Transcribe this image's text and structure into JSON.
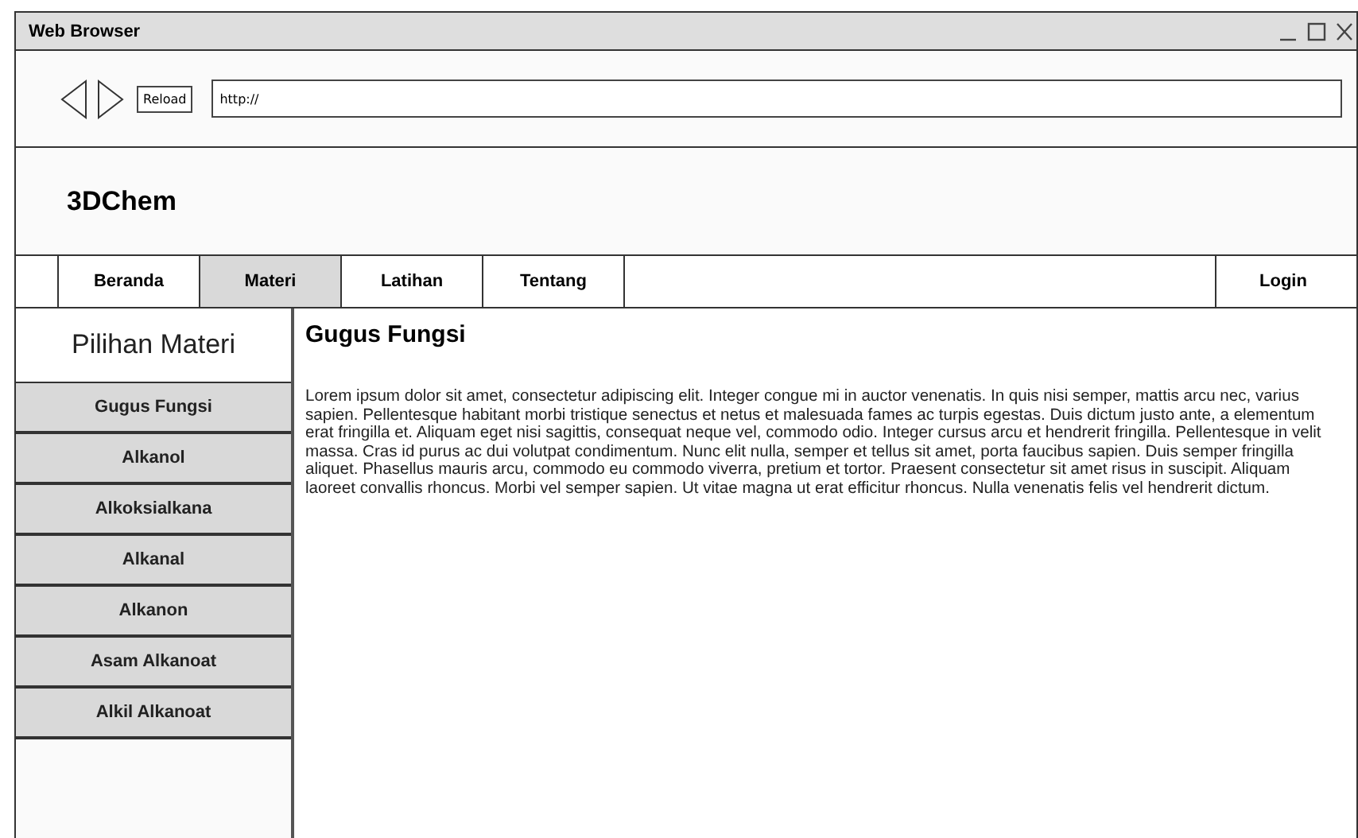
{
  "window": {
    "title": "Web Browser"
  },
  "toolbar": {
    "reload_label": "Reload",
    "address": "http://"
  },
  "site": {
    "logo": "3DChem"
  },
  "nav": {
    "tabs": [
      {
        "label": "Beranda",
        "selected": false
      },
      {
        "label": "Materi",
        "selected": true
      },
      {
        "label": "Latihan",
        "selected": false
      },
      {
        "label": "Tentang",
        "selected": false
      }
    ],
    "login": "Login"
  },
  "sidebar": {
    "title": "Pilihan Materi",
    "items": [
      "Gugus Fungsi",
      "Alkanol",
      "Alkoksialkana",
      "Alkanal",
      "Alkanon",
      "Asam Alkanoat",
      "Alkil Alkanoat"
    ]
  },
  "content": {
    "heading": "Gugus Fungsi",
    "paragraph": "Lorem ipsum dolor sit amet, consectetur adipiscing elit. Integer congue mi in auctor venenatis. In quis nisi semper, mattis arcu nec, varius sapien. Pellentesque habitant morbi tristique senectus et netus et malesuada fames ac turpis egestas. Duis dictum justo ante, a elementum erat fringilla et. Aliquam eget nisi sagittis, consequat neque vel, commodo odio. Integer cursus arcu et hendrerit fringilla. Pellentesque in velit massa. Cras id purus ac dui volutpat condimentum. Nunc elit nulla, semper et tellus sit amet, porta faucibus sapien. Duis semper fringilla aliquet. Phasellus mauris arcu, commodo eu commodo viverra, pretium et tortor. Praesent consectetur sit amet risus in suscipit. Aliquam laoreet convallis rhoncus. Morbi vel semper sapien. Ut vitae magna ut erat efficitur rhoncus. Nulla venenatis felis vel hendrerit dictum."
  }
}
